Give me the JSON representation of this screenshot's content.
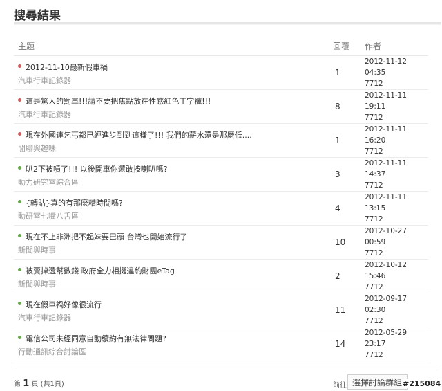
{
  "page": {
    "title": "搜尋結果"
  },
  "table": {
    "headers": {
      "subject": "主題",
      "replies": "回覆",
      "author": "作者"
    },
    "rows": [
      {
        "dot": "red",
        "title": "2012-11-10最新假車禍",
        "forum": "汽車行車記錄器",
        "replies": "1",
        "date": "2012-11-12 04:35",
        "author": "7712"
      },
      {
        "dot": "red",
        "title": "這是驚人的罰車!!!請不要把焦點放在性感紅色丁字褲!!!",
        "forum": "汽車行車記錄器",
        "replies": "8",
        "date": "2012-11-11 19:11",
        "author": "7712"
      },
      {
        "dot": "red",
        "title": "現在外國連乞丐都已經進步到到這樣了!!! 我們的薪水還是那麼低....",
        "forum": "閒聊與趣味",
        "replies": "1",
        "date": "2012-11-11 16:20",
        "author": "7712"
      },
      {
        "dot": "green",
        "title": "叭2下被噴了!!! 以後開車你還敢按喇叭嗎?",
        "forum": "動力研究室綜合區",
        "replies": "3",
        "date": "2012-11-11 14:37",
        "author": "7712"
      },
      {
        "dot": "green",
        "title": "{轉貼}真的有那麼糟時間嗎?",
        "forum": "動研室七嘴八舌區",
        "replies": "4",
        "date": "2012-11-11 13:15",
        "author": "7712"
      },
      {
        "dot": "green",
        "title": "現在不止非洲把不起妹要巴頭 台灣也開始流行了",
        "forum": "新聞與時事",
        "replies": "10",
        "date": "2012-10-27 00:59",
        "author": "7712"
      },
      {
        "dot": "green",
        "title": "被賣掉還幫數錢 政府全力相挺違約財團eTag",
        "forum": "新聞與時事",
        "replies": "2",
        "date": "2012-10-12 15:46",
        "author": "7712"
      },
      {
        "dot": "green",
        "title": "現在假車禍好像很流行",
        "forum": "汽車行車記錄器",
        "replies": "11",
        "date": "2012-09-17 02:30",
        "author": "7712"
      },
      {
        "dot": "green",
        "title": "電信公司未經同意自動續約有無法律問題?",
        "forum": "行動通訊綜合討論區",
        "replies": "14",
        "date": "2012-05-29 23:17",
        "author": "7712"
      }
    ]
  },
  "pagination": {
    "prefix": "第",
    "current": "1",
    "suffix": "頁 (共1頁)"
  },
  "jump": {
    "label": "前往",
    "select_value": "選擇討論群組"
  },
  "watermark": "#215084",
  "colors": {
    "red_dot": "#cf5a5a",
    "green_dot": "#6aa84f"
  }
}
